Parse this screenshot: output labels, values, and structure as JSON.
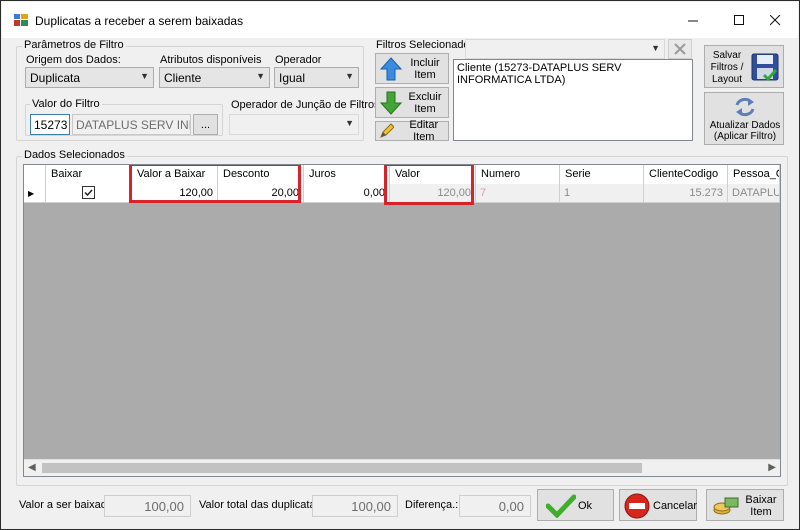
{
  "window": {
    "title": "Duplicatas a receber a serem baixadas"
  },
  "filter_params": {
    "group_title": "Parâmetros de Filtro",
    "origin_label": "Origem dos Dados:",
    "origin_value": "Duplicata",
    "attributes_label": "Atributos disponíveis",
    "attributes_value": "Cliente",
    "operator_label": "Operador",
    "operator_value": "Igual",
    "filter_value_label": "Valor do Filtro",
    "filter_code": "15273",
    "filter_name": "DATAPLUS SERV INF",
    "browse_label": "...",
    "join_operator_label": "Operador de Junção de Filtros",
    "join_operator_value": ""
  },
  "selected_filters": {
    "label": "Filtros Selecionados",
    "combo_value": "",
    "include_label": "Incluir Item",
    "exclude_label": "Excluir Item",
    "edit_label": "Editar Item",
    "items": [
      "Cliente (15273-DATAPLUS SERV INFORMATICA LTDA)"
    ]
  },
  "toolbar": {
    "save_label": "Salvar Filtros / Layout",
    "refresh_label": "Atualizar Dados (Aplicar Filtro)"
  },
  "data_group": {
    "label": "Dados Selecionados"
  },
  "grid": {
    "columns": [
      "Baixar",
      "Valor a Baixar",
      "Desconto",
      "Juros",
      "Valor",
      "Numero",
      "Serie",
      "ClienteCodigo",
      "Pessoa_Cl"
    ],
    "rows": [
      {
        "baixar": true,
        "valor_a_baixar": "120,00",
        "desconto": "20,00",
        "juros": "0,00",
        "valor": "120,00",
        "numero": "7",
        "serie": "1",
        "cliente_codigo": "15.273",
        "pessoa": "DATAPLUS"
      }
    ],
    "highlight_color": "#d8232a"
  },
  "footer": {
    "valor_baixado_label": "Valor a ser baixado.:",
    "valor_baixado": "100,00",
    "valor_total_label": "Valor total das duplicatas.:",
    "valor_total": "100,00",
    "diferenca_label": "Diferença.:",
    "diferenca": "0,00",
    "ok_label": "Ok",
    "cancel_label": "Cancelar",
    "baixar_label": "Baixar Item"
  }
}
